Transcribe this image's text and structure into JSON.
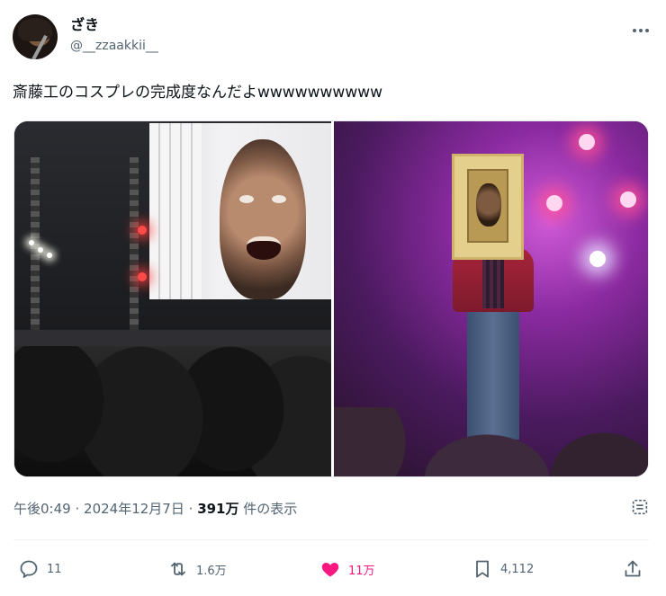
{
  "author": {
    "display_name": "ざき",
    "handle": "@__zzaakkii__"
  },
  "tweet": {
    "text": "斎藤工のコスプレの完成度なんだよwwwwwwwwww"
  },
  "meta": {
    "time": "午後0:49",
    "separator": "·",
    "date": "2024年12月7日",
    "views_count": "391万",
    "views_label": "件の表示"
  },
  "actions": {
    "replies": "11",
    "reposts": "1.6万",
    "likes": "11万",
    "bookmarks": "4,112"
  },
  "colors": {
    "like_active": "#f91880",
    "secondary_text": "#536471",
    "primary_text": "#0f1419"
  },
  "icons": {
    "more": "more-horizontal-icon",
    "reply": "reply-icon",
    "retweet": "retweet-icon",
    "like": "heart-filled-icon",
    "bookmark": "bookmark-icon",
    "share": "share-icon",
    "stats": "view-stats-icon"
  }
}
